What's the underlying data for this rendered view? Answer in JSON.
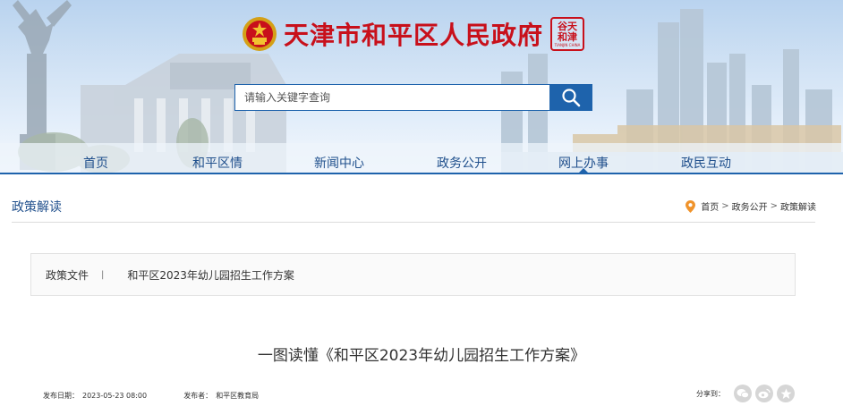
{
  "header": {
    "site_title": "天津市和平区人民政府",
    "seal_line1": "谷天",
    "seal_line2": "和津",
    "seal_en": "TIANJIN CHINA"
  },
  "search": {
    "placeholder": "请输入关键字查询",
    "icon": "search-icon"
  },
  "nav": {
    "items": [
      {
        "label": "首页"
      },
      {
        "label": "和平区情"
      },
      {
        "label": "新闻中心"
      },
      {
        "label": "政务公开"
      },
      {
        "label": "网上办事"
      },
      {
        "label": "政民互动"
      }
    ],
    "active_index": 4
  },
  "section": {
    "title": "政策解读",
    "breadcrumb": [
      {
        "label": "首页"
      },
      {
        "label": "政务公开"
      },
      {
        "label": "政策解读"
      }
    ],
    "breadcrumb_separator": ">"
  },
  "doc": {
    "label": "政策文件",
    "divider": "|",
    "name": "和平区2023年幼儿园招生工作方案"
  },
  "article": {
    "title": "一图读懂《和平区2023年幼儿园招生工作方案》",
    "date_label": "发布日期：",
    "date": "2023-05-23 08:00",
    "publisher_label": "发布者：",
    "publisher": "和平区教育局",
    "share_label": "分享到："
  },
  "share_icons": [
    "wechat-icon",
    "weibo-icon",
    "favorite-icon"
  ],
  "colors": {
    "brand_red": "#c8101b",
    "nav_blue": "#1e63ac",
    "text_blue": "#1f4f8c"
  }
}
